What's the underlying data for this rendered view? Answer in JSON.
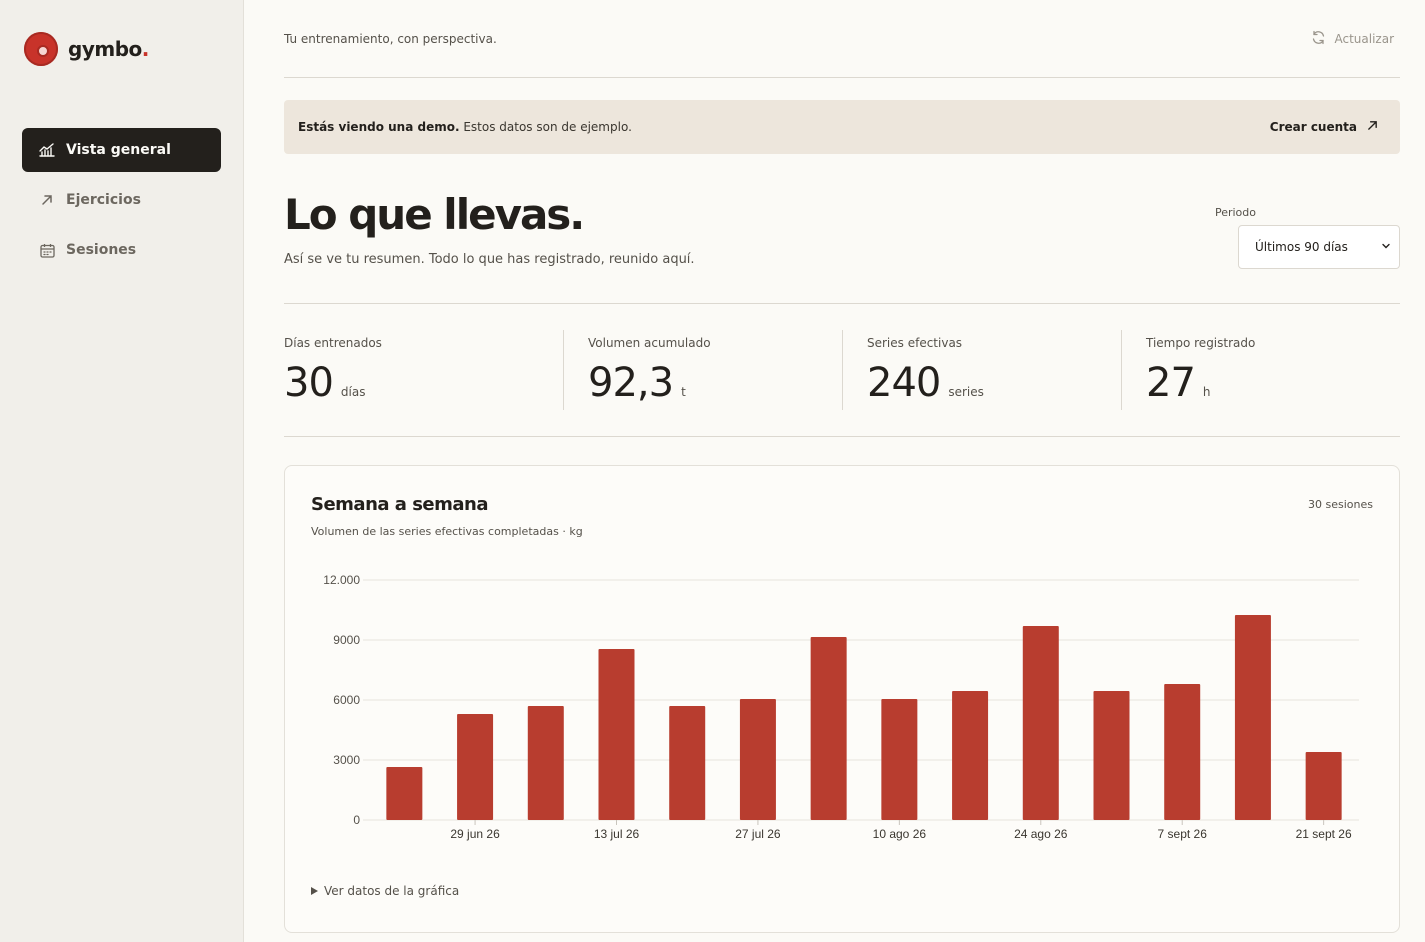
{
  "app": {
    "name": "gymbo",
    "name_dot": "."
  },
  "sidebar": {
    "items": [
      {
        "label": "Vista general",
        "icon": "chart-line-icon",
        "active": true
      },
      {
        "label": "Ejercicios",
        "icon": "arrow-up-right-icon",
        "active": false
      },
      {
        "label": "Sesiones",
        "icon": "calendar-icon",
        "active": false
      }
    ]
  },
  "header": {
    "tagline": "Tu entrenamiento, con perspectiva.",
    "refresh_label": "Actualizar"
  },
  "banner": {
    "bold": "Estás viendo una demo.",
    "text": " Estos datos son de ejemplo.",
    "cta": "Crear cuenta"
  },
  "hero": {
    "title": "Lo que llevas.",
    "subtitle": "Así se ve tu resumen. Todo lo que has registrado, reunido aquí.",
    "period_label": "Periodo",
    "period_value": "Últimos 90 días"
  },
  "stats": [
    {
      "label": "Días entrenados",
      "value": "30",
      "unit": "días"
    },
    {
      "label": "Volumen acumulado",
      "value": "92,3",
      "unit": "t"
    },
    {
      "label": "Series efectivas",
      "value": "240",
      "unit": "series"
    },
    {
      "label": "Tiempo registrado",
      "value": "27",
      "unit": "h"
    }
  ],
  "chart_card": {
    "title": "Semana a semana",
    "subtitle": "Volumen de las series efectivas completadas · kg",
    "count": "30 sesiones",
    "toggle": "Ver datos de la gráfica"
  },
  "colors": {
    "accent": "#b83d2f",
    "dark": "#23201c",
    "banner": "#ede6dc"
  },
  "chart_data": {
    "type": "bar",
    "values": [
      2650,
      5300,
      5700,
      8550,
      5700,
      6050,
      9150,
      6050,
      6450,
      9700,
      6450,
      6800,
      10250,
      3400
    ],
    "x_tick_labels": [
      {
        "index": 1.5,
        "label": "29 jun 26"
      },
      {
        "index": 3.5,
        "label": "13 jul 26"
      },
      {
        "index": 5.5,
        "label": "27 jul 26"
      },
      {
        "index": 7.5,
        "label": "10 ago 26"
      },
      {
        "index": 9.5,
        "label": "24 ago 26"
      },
      {
        "index": 11.5,
        "label": "7 sept 26"
      },
      {
        "index": 13.5,
        "label": "21 sept 26"
      }
    ],
    "y_ticks": [
      0,
      3000,
      6000,
      9000,
      12000
    ],
    "y_tick_labels": [
      "0",
      "3000",
      "6000",
      "9000",
      "12.000"
    ],
    "ylim": [
      0,
      12000
    ],
    "grid": true,
    "color": "#b83d2f"
  }
}
